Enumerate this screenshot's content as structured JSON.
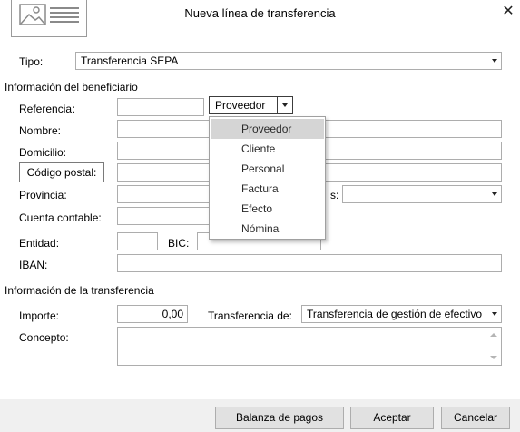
{
  "window": {
    "title": "Nueva línea de transferencia",
    "close_glyph": "✕"
  },
  "tipo": {
    "label": "Tipo:",
    "value": "Transferencia SEPA"
  },
  "beneficiario": {
    "section": "Información del beneficiario",
    "referencia_label": "Referencia:",
    "referencia_value": "",
    "ref_type_selected": "Proveedor",
    "ref_type_options": [
      "Proveedor",
      "Cliente",
      "Personal",
      "Factura",
      "Efecto",
      "Nómina"
    ],
    "nombre_label": "Nombre:",
    "domicilio_label": "Domicilio:",
    "codigo_postal_label": "Código postal:",
    "provincia_label": "Provincia:",
    "pais_label_tail": "s:",
    "cuenta_contable_label": "Cuenta contable:",
    "entidad_label": "Entidad:",
    "bic_label": "BIC:",
    "iban_label": "IBAN:"
  },
  "transferencia": {
    "section": "Información de la transferencia",
    "importe_label": "Importe:",
    "importe_value": "0,00",
    "transferencia_de_label": "Transferencia de:",
    "transferencia_de_value": "Transferencia de gestión de efectivo",
    "concepto_label": "Concepto:"
  },
  "footer": {
    "balanza_label": "Balanza de pagos",
    "aceptar_label": "Aceptar",
    "cancelar_label": "Cancelar"
  },
  "colors": {
    "menu_selected_bg": "#d5d5d5",
    "footer_bg": "#f0f0f0"
  }
}
